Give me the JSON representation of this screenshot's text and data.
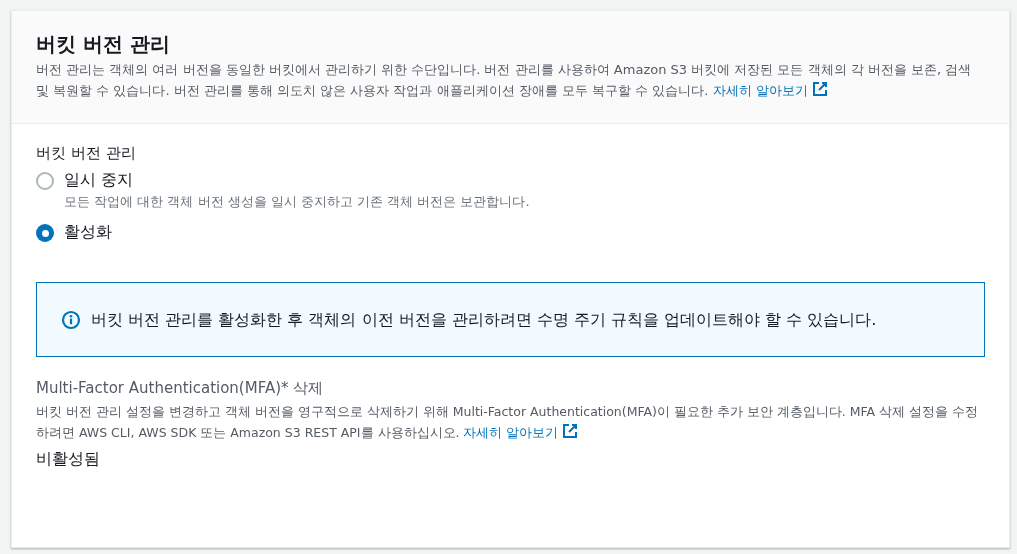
{
  "header": {
    "title": "버킷 버전 관리",
    "description": "버전 관리는 객체의 여러 버전을 동일한 버킷에서 관리하기 위한 수단입니다. 버전 관리를 사용하여 Amazon S3 버킷에 저장된 모든 객체의 각 버전을 보존, 검색 및 복원할 수 있습니다. 버전 관리를 통해 의도치 않은 사용자 작업과 애플리케이션 장애를 모두 복구할 수 있습니다.",
    "link": "자세히 알아보기"
  },
  "versioning": {
    "label": "버킷 버전 관리",
    "options": [
      {
        "label": "일시 중지",
        "description": "모든 작업에 대한 객체 버전 생성을 일시 중지하고 기존 객체 버전은 보관합니다.",
        "selected": false
      },
      {
        "label": "활성화",
        "selected": true
      }
    ]
  },
  "info_alert": {
    "text": "버킷 버전 관리를 활성화한 후 객체의 이전 버전을 관리하려면 수명 주기 규칙을 업데이트해야 할 수 있습니다."
  },
  "mfa": {
    "label": "Multi-Factor Authentication(MFA)* 삭제",
    "description": "버킷 버전 관리 설정을 변경하고 객체 버전을 영구적으로 삭제하기 위해 Multi-Factor Authentication(MFA)이 필요한 추가 보안 계층입니다. MFA 삭제 설정을 수정하려면 AWS CLI, AWS SDK 또는 Amazon S3 REST API를 사용하십시오.",
    "link": "자세히 알아보기",
    "value": "비활성됨"
  }
}
